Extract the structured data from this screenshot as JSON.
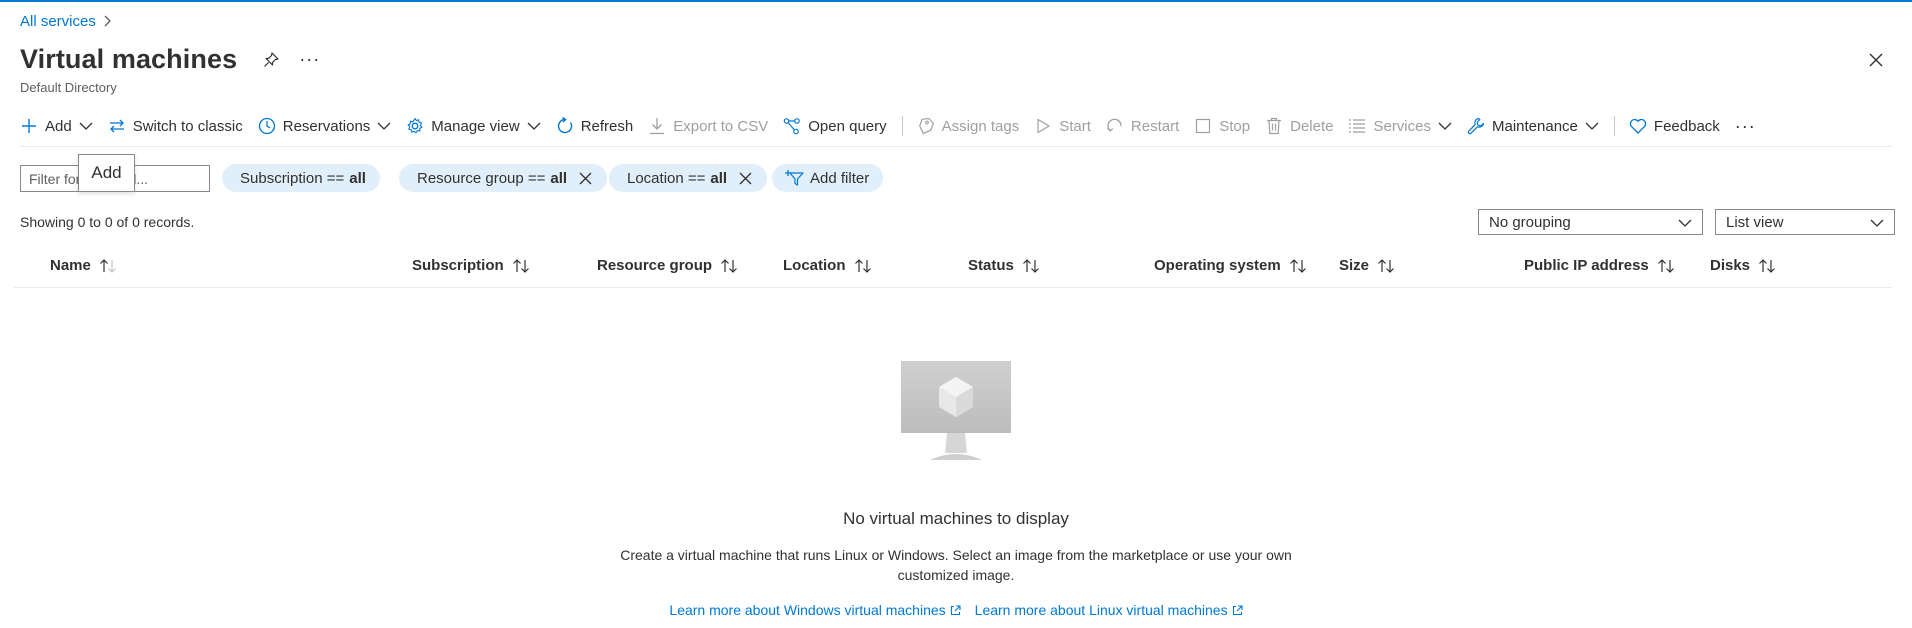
{
  "breadcrumb": {
    "root": "All services"
  },
  "header": {
    "title": "Virtual machines",
    "subtitle": "Default Directory",
    "more": "···"
  },
  "toolbar": {
    "add": "Add",
    "switch_classic": "Switch to classic",
    "reservations": "Reservations",
    "manage_view": "Manage view",
    "refresh": "Refresh",
    "export_csv": "Export to CSV",
    "open_query": "Open query",
    "assign_tags": "Assign tags",
    "start": "Start",
    "restart": "Restart",
    "stop": "Stop",
    "delete": "Delete",
    "services": "Services",
    "maintenance": "Maintenance",
    "feedback": "Feedback",
    "more": "···"
  },
  "tooltip": {
    "text": "Add"
  },
  "filters": {
    "search_placeholder": "Filter for any field...",
    "subscription": {
      "label": "Subscription ==",
      "value": "all"
    },
    "resource_group": {
      "label": "Resource group ==",
      "value": "all"
    },
    "location": {
      "label": "Location ==",
      "value": "all"
    },
    "add_filter": "Add filter"
  },
  "records": {
    "showing": "Showing 0 to 0 of 0 records."
  },
  "grouping": {
    "selected": "No grouping"
  },
  "view": {
    "selected": "List view"
  },
  "table": {
    "columns": [
      "Name",
      "Subscription",
      "Resource group",
      "Location",
      "Status",
      "Operating system",
      "Size",
      "Public IP address",
      "Disks"
    ]
  },
  "empty": {
    "title": "No virtual machines to display",
    "description": "Create a virtual machine that runs Linux or Windows. Select an image from the marketplace or use your own customized image.",
    "link_windows": "Learn more about Windows virtual machines",
    "link_linux": "Learn more about Linux virtual machines"
  },
  "colors": {
    "accent": "#0078d4",
    "pill": "#e1effa",
    "disabled": "#a19f9d"
  }
}
